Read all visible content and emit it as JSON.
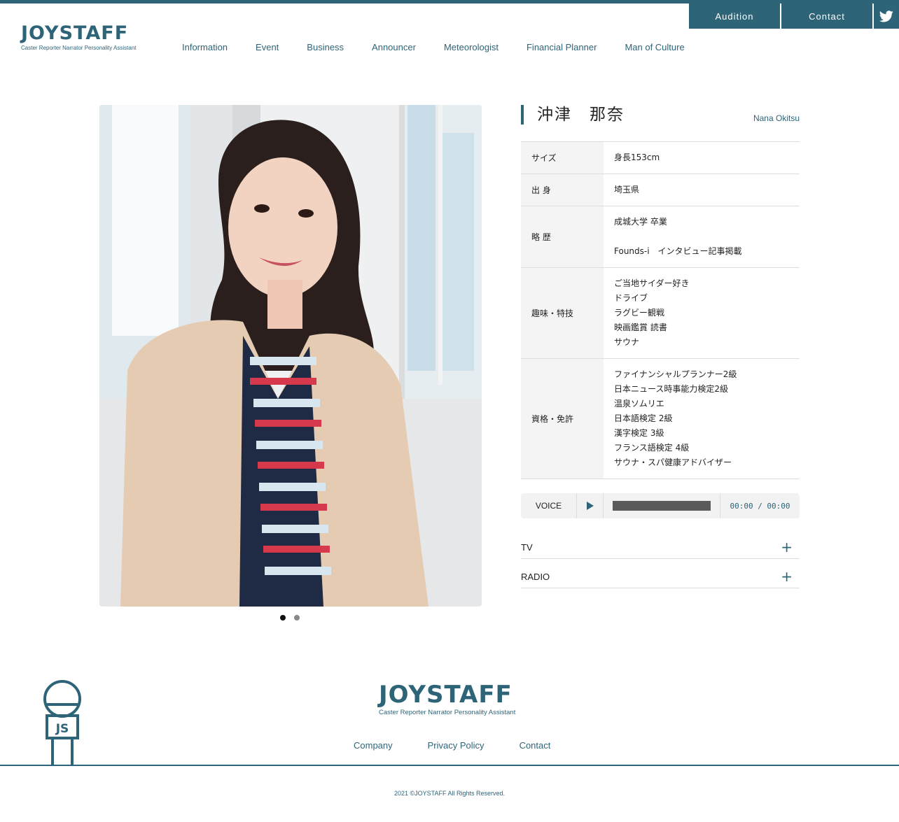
{
  "brand": {
    "name": "JOYSTAFF",
    "tagline": "Caster Reporter Narrator Personality Assistant",
    "primary_color": "#2e6478"
  },
  "top_buttons": {
    "audition": "Audition",
    "contact": "Contact",
    "twitter_icon": "twitter-icon"
  },
  "nav": {
    "items": [
      {
        "label": "Information"
      },
      {
        "label": "Event"
      },
      {
        "label": "Business"
      },
      {
        "label": "Announcer"
      },
      {
        "label": "Meteorologist"
      },
      {
        "label": "Financial Planner"
      },
      {
        "label": "Man of Culture"
      }
    ]
  },
  "gallery": {
    "dots": [
      {
        "active": true,
        "color": "#111111"
      },
      {
        "active": false,
        "color": "#888888"
      }
    ]
  },
  "profile": {
    "name_jp": "沖津　那奈",
    "name_en": "Nana Okitsu",
    "rows": [
      {
        "key": "サイズ",
        "lines": [
          "身長153cm"
        ]
      },
      {
        "key": "出 身",
        "lines": [
          "埼玉県"
        ]
      },
      {
        "key": "略 歴",
        "lines": [
          "成城大学 卒業",
          "",
          "Founds-i　インタビュー記事掲載"
        ]
      },
      {
        "key": "趣味・特技",
        "lines": [
          "ご当地サイダー好き",
          "ドライブ",
          "ラグビー観戦",
          "映画鑑賞 読書",
          "サウナ"
        ]
      },
      {
        "key": "資格・免許",
        "lines": [
          "ファイナンシャルプランナー2級",
          "日本ニュース時事能力検定2級",
          "温泉ソムリエ",
          "日本語検定 2級",
          "漢字検定 3級",
          "フランス語検定 4級",
          "サウナ・スパ健康アドバイザー"
        ]
      }
    ]
  },
  "voice": {
    "label": "VOICE",
    "time": "00:00 / 00:00",
    "progress": 0
  },
  "accordion": [
    {
      "label": "TV"
    },
    {
      "label": "RADIO"
    }
  ],
  "footer": {
    "mic_badge": "JS",
    "links": [
      {
        "label": "Company"
      },
      {
        "label": "Privacy Policy"
      },
      {
        "label": "Contact"
      }
    ],
    "copyright": "2021 ©JOYSTAFF All Rights Reserved."
  }
}
